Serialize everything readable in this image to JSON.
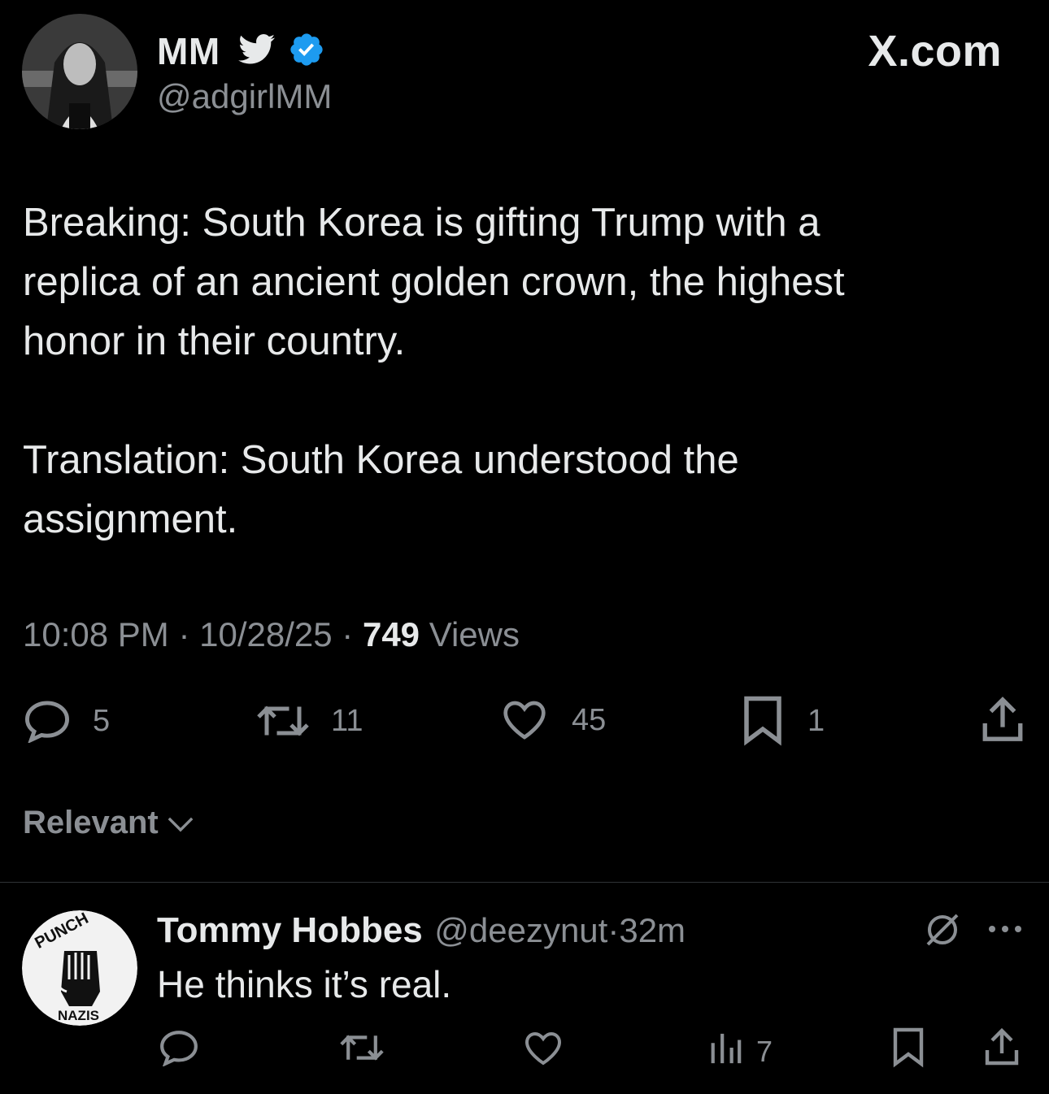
{
  "header": {
    "name": "MM",
    "handle": "@adgirlMM",
    "brand": "X.com"
  },
  "tweet": {
    "paragraph1_lines": [
      "Breaking: South Korea is gifting Trump with a",
      "replica of an ancient golden crown, the highest",
      "honor in  their country."
    ],
    "paragraph2_lines": [
      "Translation: South Korea understood the",
      "assignment."
    ],
    "time": "10:08 PM",
    "date": "10/28/25",
    "views_count": "749",
    "views_label": "Views",
    "sep": "·"
  },
  "actions": {
    "replies": "5",
    "reposts": "11",
    "likes": "45",
    "bookmarks": "1"
  },
  "sort": {
    "label": "Relevant"
  },
  "reply": {
    "name": "Tommy Hobbes",
    "handle": "@deezynut",
    "sep": "·",
    "time": "32m",
    "text": "He thinks it’s real.",
    "views": "7",
    "avatar_top_text": "PUNCH",
    "avatar_bottom_text": "NAZIS"
  },
  "colors": {
    "background": "#000000",
    "text": "#e7e9ea",
    "muted": "#8b8f94",
    "verified": "#1d9bf0"
  },
  "icons": [
    "bird-icon",
    "verified-badge-icon",
    "reply-icon",
    "repost-icon",
    "like-icon",
    "bookmark-icon",
    "share-icon",
    "chevron-down-icon",
    "grok-icon",
    "more-icon",
    "views-icon"
  ]
}
